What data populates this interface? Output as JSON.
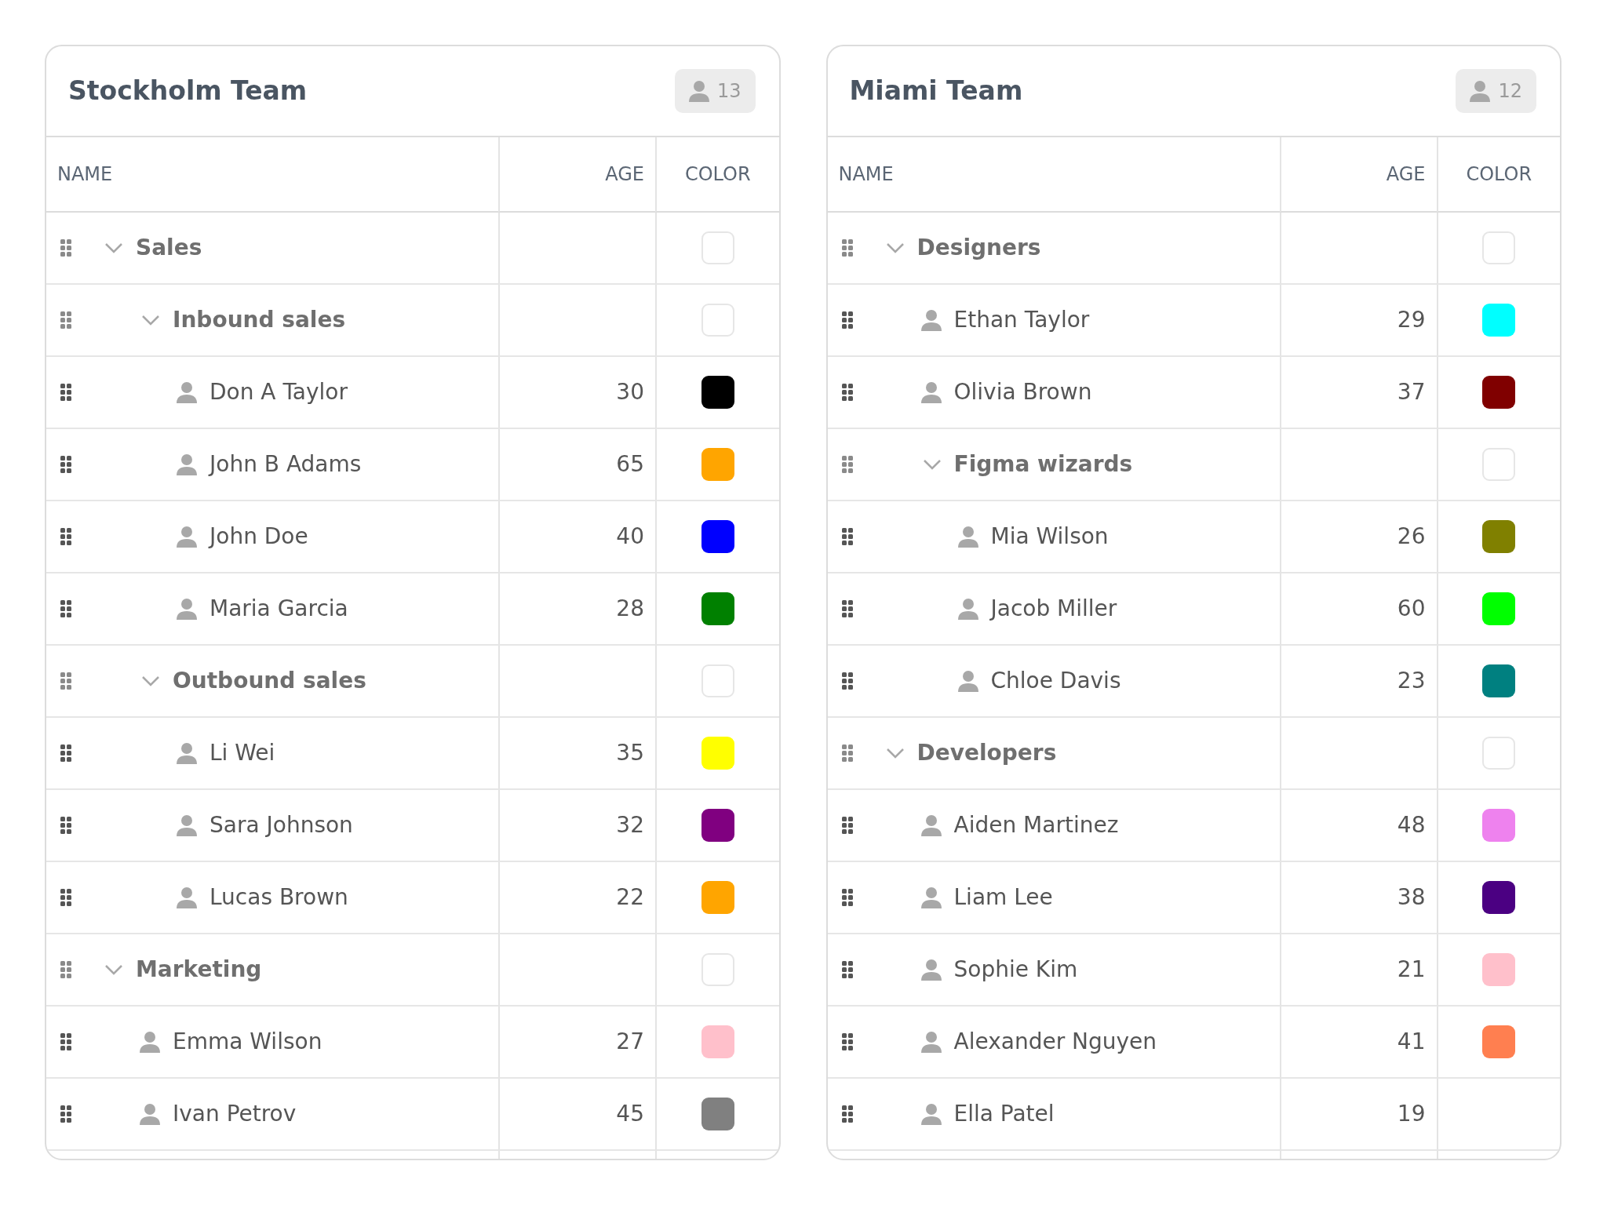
{
  "teams": [
    {
      "title": "Stockholm Team",
      "member_count": "13",
      "columns": [
        "NAME",
        "AGE",
        "COLOR"
      ],
      "rows": [
        {
          "kind": "group",
          "name": "Sales",
          "expanded": true,
          "children": [
            {
              "kind": "group",
              "name": "Inbound sales",
              "expanded": true,
              "children": [
                {
                  "kind": "person",
                  "name": "Don A Taylor",
                  "age": "30",
                  "color": "#000000"
                },
                {
                  "kind": "person",
                  "name": "John B Adams",
                  "age": "65",
                  "color": "#ffa500"
                },
                {
                  "kind": "person",
                  "name": "John Doe",
                  "age": "40",
                  "color": "#0000ff"
                },
                {
                  "kind": "person",
                  "name": "Maria Garcia",
                  "age": "28",
                  "color": "#008000"
                }
              ]
            },
            {
              "kind": "group",
              "name": "Outbound sales",
              "expanded": true,
              "children": [
                {
                  "kind": "person",
                  "name": "Li Wei",
                  "age": "35",
                  "color": "#ffff00"
                },
                {
                  "kind": "person",
                  "name": "Sara Johnson",
                  "age": "32",
                  "color": "#800080"
                },
                {
                  "kind": "person",
                  "name": "Lucas Brown",
                  "age": "22",
                  "color": "#ffa500"
                }
              ]
            }
          ]
        },
        {
          "kind": "group",
          "name": "Marketing",
          "expanded": true,
          "children": [
            {
              "kind": "person",
              "name": "Emma Wilson",
              "age": "27",
              "color": "#ffc0cb"
            },
            {
              "kind": "person",
              "name": "Ivan Petrov",
              "age": "45",
              "color": "#808080"
            }
          ]
        }
      ]
    },
    {
      "title": "Miami Team",
      "member_count": "12",
      "columns": [
        "NAME",
        "AGE",
        "COLOR"
      ],
      "rows": [
        {
          "kind": "group",
          "name": "Designers",
          "expanded": true,
          "children": [
            {
              "kind": "person",
              "name": "Ethan Taylor",
              "age": "29",
              "color": "#00ffff"
            },
            {
              "kind": "person",
              "name": "Olivia Brown",
              "age": "37",
              "color": "#800000"
            },
            {
              "kind": "group",
              "name": "Figma wizards",
              "expanded": true,
              "children": [
                {
                  "kind": "person",
                  "name": "Mia Wilson",
                  "age": "26",
                  "color": "#808000"
                },
                {
                  "kind": "person",
                  "name": "Jacob Miller",
                  "age": "60",
                  "color": "#00ff00"
                },
                {
                  "kind": "person",
                  "name": "Chloe Davis",
                  "age": "23",
                  "color": "#008080"
                }
              ]
            }
          ]
        },
        {
          "kind": "group",
          "name": "Developers",
          "expanded": true,
          "children": [
            {
              "kind": "person",
              "name": "Aiden Martinez",
              "age": "48",
              "color": "#ee82ee"
            },
            {
              "kind": "person",
              "name": "Liam Lee",
              "age": "38",
              "color": "#4b0082"
            },
            {
              "kind": "person",
              "name": "Sophie Kim",
              "age": "21",
              "color": "#ffc0cb"
            },
            {
              "kind": "person",
              "name": "Alexander Nguyen",
              "age": "41",
              "color": "#ff7f50"
            },
            {
              "kind": "person",
              "name": "Ella Patel",
              "age": "19"
            }
          ]
        }
      ]
    }
  ]
}
